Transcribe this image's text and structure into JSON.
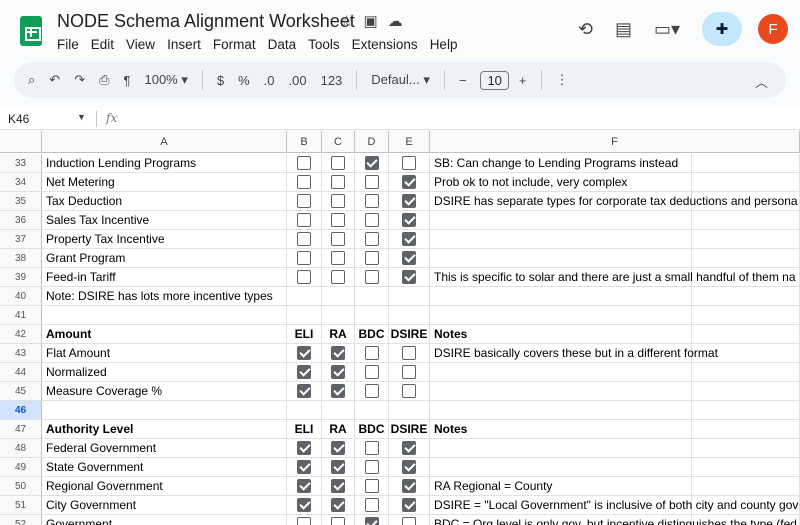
{
  "app": {
    "title": "NODE Schema Alignment Worksheet",
    "menu": [
      "File",
      "Edit",
      "View",
      "Insert",
      "Format",
      "Data",
      "Tools",
      "Extensions",
      "Help"
    ],
    "avatar_letter": "F",
    "title_icons": [
      "star-icon",
      "move-folder-icon",
      "cloud-status-icon"
    ],
    "accent_color": "#0f9d58"
  },
  "toolbar": {
    "zoom": "100%",
    "currency": "$",
    "percent": "%",
    "dec_decrease": ".0",
    "dec_increase": ".00",
    "number_format": "123",
    "font": "Defaul...",
    "font_size": "10",
    "minus": "−",
    "plus": "+"
  },
  "formula": {
    "cell_ref": "K46",
    "fx": "fx"
  },
  "columns": [
    "A",
    "B",
    "C",
    "D",
    "E",
    "F"
  ],
  "rows": [
    {
      "num": "33",
      "a": "Induction Lending Programs",
      "b": false,
      "c": false,
      "d": true,
      "e": false,
      "f": "SB: Can change to Lending Programs instead",
      "flag": true
    },
    {
      "num": "34",
      "a": "Net Metering",
      "b": false,
      "c": false,
      "d": false,
      "e": true,
      "f": "Prob ok to not include, very complex"
    },
    {
      "num": "35",
      "a": "Tax Deduction",
      "b": false,
      "c": false,
      "d": false,
      "e": true,
      "f": "DSIRE has separate types for corporate tax deductions and persona"
    },
    {
      "num": "36",
      "a": "Sales Tax Incentive",
      "b": false,
      "c": false,
      "d": false,
      "e": true,
      "f": ""
    },
    {
      "num": "37",
      "a": "Property Tax Incentive",
      "b": false,
      "c": false,
      "d": false,
      "e": true,
      "f": ""
    },
    {
      "num": "38",
      "a": "Grant Program",
      "b": false,
      "c": false,
      "d": false,
      "e": true,
      "f": ""
    },
    {
      "num": "39",
      "a": "Feed-in Tariff",
      "b": false,
      "c": false,
      "d": false,
      "e": true,
      "f": "This is specific to solar and there are just a small handful of them na"
    },
    {
      "num": "40",
      "a": "Note: DSIRE has lots more incentive types",
      "f": ""
    },
    {
      "num": "41",
      "a": "",
      "f": ""
    },
    {
      "num": "42",
      "a": "Amount",
      "header": true,
      "hb": "ELI",
      "hc": "RA",
      "hd": "BDC",
      "he": "DSIRE",
      "f": "Notes"
    },
    {
      "num": "43",
      "a": "Flat Amount",
      "b": true,
      "c": true,
      "d": false,
      "e": false,
      "f": "DSIRE basically covers these but in a different format"
    },
    {
      "num": "44",
      "a": "Normalized",
      "b": true,
      "c": true,
      "d": false,
      "e": false,
      "f": ""
    },
    {
      "num": "45",
      "a": "Measure Coverage %",
      "b": true,
      "c": true,
      "d": false,
      "e": false,
      "f": ""
    },
    {
      "num": "46",
      "a": "",
      "f": "",
      "selected": true
    },
    {
      "num": "47",
      "a": "Authority Level",
      "header": true,
      "hb": "ELI",
      "hc": "RA",
      "hd": "BDC",
      "he": "DSIRE",
      "f": "Notes"
    },
    {
      "num": "48",
      "a": "Federal Government",
      "b": true,
      "c": true,
      "d": false,
      "e": true,
      "f": ""
    },
    {
      "num": "49",
      "a": "State Government",
      "b": true,
      "c": true,
      "d": false,
      "e": true,
      "f": ""
    },
    {
      "num": "50",
      "a": "Regional Government",
      "b": true,
      "c": true,
      "d": false,
      "e": true,
      "f": "RA Regional = County"
    },
    {
      "num": "51",
      "a": "City Government",
      "b": true,
      "c": true,
      "d": false,
      "e": true,
      "f": "DSIRE = \"Local Government\" is inclusive of both city and county gov"
    },
    {
      "num": "52",
      "a": "Government",
      "b": false,
      "c": false,
      "d": true,
      "e": false,
      "f": "BDC = Org level is only gov, but incentive distinguishes the type (fed"
    }
  ]
}
